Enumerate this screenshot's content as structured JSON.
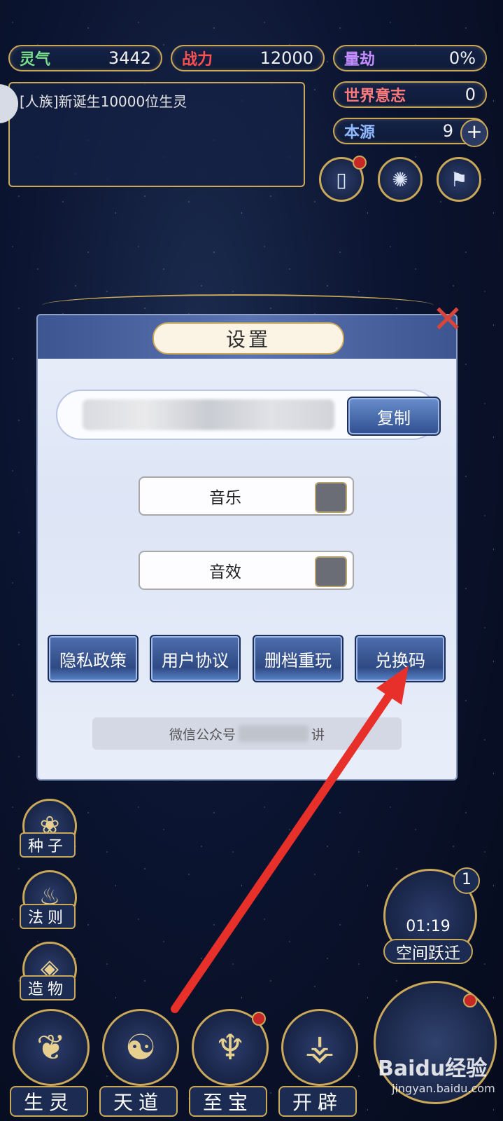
{
  "stats": {
    "lingqi": {
      "label": "灵气",
      "value": "3442"
    },
    "zhanli": {
      "label": "战力",
      "value": "12000"
    },
    "liangjie": {
      "label": "量劫",
      "value": "0%"
    },
    "shijie": {
      "label": "世界意志",
      "value": "0"
    },
    "benyuan": {
      "label": "本源",
      "value": "9",
      "add": "+"
    }
  },
  "message": "[人族]新诞生10000位生灵",
  "dialog": {
    "title": "设置",
    "copy_label": "复制",
    "music_label": "音乐",
    "sound_label": "音效",
    "buttons": [
      "隐私政策",
      "用户协议",
      "删档重玩",
      "兑换码"
    ],
    "wechat_prefix": "微信公众号",
    "wechat_suffix": "讲"
  },
  "left_buttons": [
    "种子",
    "法则",
    "造物"
  ],
  "jump": {
    "timer": "01:19",
    "label": "空间跃迁",
    "badge": "1"
  },
  "nav": [
    "生灵",
    "天道",
    "至宝",
    "开辟"
  ],
  "watermark": {
    "logo": "Baidu经验",
    "url": "jingyan.baidu.com"
  },
  "colors": {
    "gold": "#c9a85a",
    "arrow": "#e8302a",
    "lingqi": "#7be08a",
    "zhanli": "#ff5050",
    "liangjie": "#c58cff",
    "shijie": "#ff7b7b",
    "benyuan": "#8fb8ff"
  }
}
